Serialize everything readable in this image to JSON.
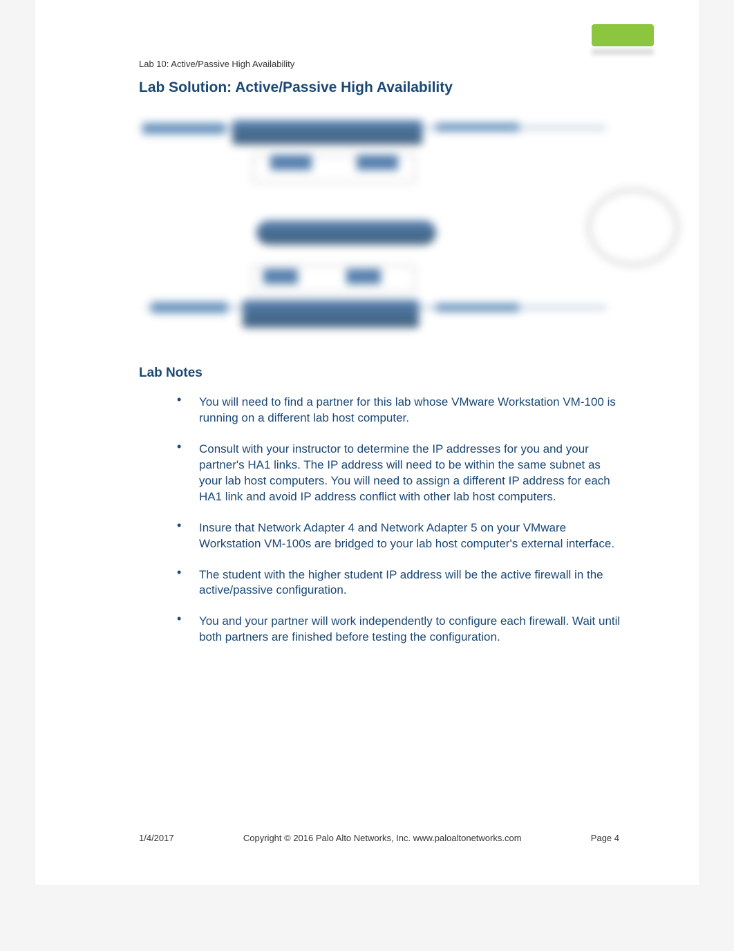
{
  "header": {
    "label": "Lab 10: Active/Passive High Availability"
  },
  "title": "Lab Solution:  Active/Passive High Availability",
  "section_heading": "Lab Notes",
  "notes": [
    "You will need to find a partner for this lab whose VMware Workstation VM-100 is running on a different lab host computer.",
    "Consult with your instructor to determine the IP addresses for you and your partner's HA1 links.  The IP address will need to be within the same subnet as your lab host computers. You will need to assign a different IP address for each HA1 link and avoid IP address conflict with other lab host computers.",
    "Insure that Network Adapter 4 and Network Adapter 5 on your VMware Workstation VM-100s are bridged to your lab host computer's external interface.",
    "The student with the higher student IP address will be the active firewall in the active/passive configuration.",
    "You and your partner will work independently to configure each firewall. Wait until both partners are finished before testing the configuration."
  ],
  "footer": {
    "date": "1/4/2017",
    "copyright": "Copyright © 2016 Palo Alto Networks, Inc. www.paloaltonetworks.com",
    "page": "Page 4"
  }
}
